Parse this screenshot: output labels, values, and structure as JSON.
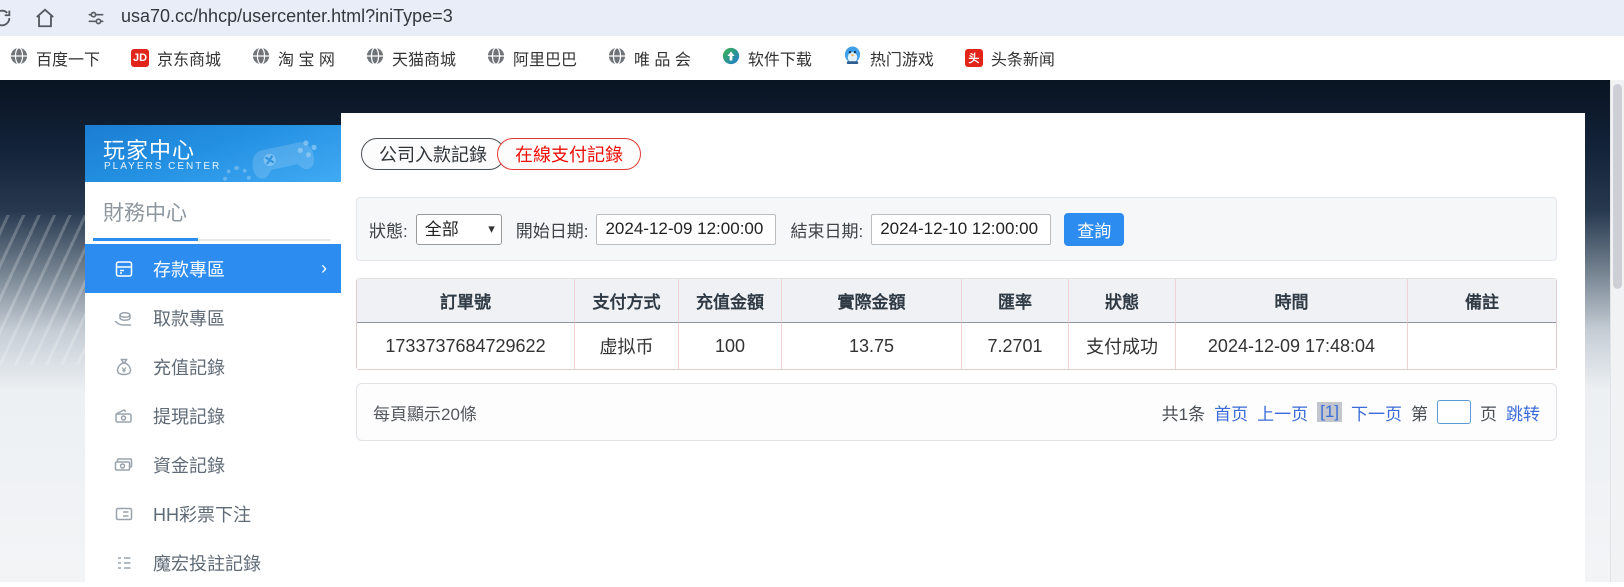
{
  "browser": {
    "url": "usa70.cc/hhcp/usercenter.html?iniType=3",
    "bookmarks": [
      {
        "label": "百度一下",
        "icon": "globe-icon"
      },
      {
        "label": "京东商城",
        "icon": "jd-icon",
        "badge": "JD",
        "badge_color": "#e1251b"
      },
      {
        "label": "淘 宝 网",
        "icon": "globe-icon"
      },
      {
        "label": "天猫商城",
        "icon": "globe-icon"
      },
      {
        "label": "阿里巴巴",
        "icon": "globe-icon"
      },
      {
        "label": "唯 品 会",
        "icon": "globe-icon"
      },
      {
        "label": "软件下载",
        "icon": "software-icon"
      },
      {
        "label": "热门游戏",
        "icon": "game-icon"
      },
      {
        "label": "头条新闻",
        "icon": "toutiao-icon",
        "badge": "头",
        "badge_color": "#e1251b"
      }
    ]
  },
  "sidebar": {
    "title": "玩家中心",
    "subtitle": "PLAYERS CENTER",
    "section": "財務中心",
    "items": [
      {
        "label": "存款專區",
        "active": true
      },
      {
        "label": "取款專區"
      },
      {
        "label": "充值記錄"
      },
      {
        "label": "提現記錄"
      },
      {
        "label": "資金記錄"
      },
      {
        "label": "HH彩票下注"
      },
      {
        "label": "魔宏投註記錄"
      }
    ]
  },
  "tabs": [
    {
      "label": "公司入款記錄"
    },
    {
      "label": "在線支付記錄",
      "active": true
    }
  ],
  "filter": {
    "status_label": "狀態:",
    "status_value": "全部",
    "start_label": "開始日期:",
    "start_value": "2024-12-09 12:00:00",
    "end_label": "結束日期:",
    "end_value": "2024-12-10 12:00:00",
    "search_label": "查詢"
  },
  "table": {
    "headers": [
      "訂單號",
      "支付方式",
      "充值金額",
      "實際金額",
      "匯率",
      "狀態",
      "時間",
      "備註"
    ],
    "rows": [
      [
        "1733737684729622",
        "虚拟币",
        "100",
        "13.75",
        "7.2701",
        "支付成功",
        "2024-12-09 17:48:04",
        ""
      ]
    ]
  },
  "pagination": {
    "page_size_text": "每頁顯示20條",
    "total_text": "共1条",
    "first_label": "首页",
    "prev_label": "上一页",
    "current_label": "[1]",
    "next_label": "下一页",
    "jump_pre_label": "第",
    "jump_post_label": "页",
    "jump_label": "跳转",
    "jump_value": ""
  },
  "colors": {
    "accent": "#2d8cf0",
    "danger": "#ec0f0a"
  }
}
